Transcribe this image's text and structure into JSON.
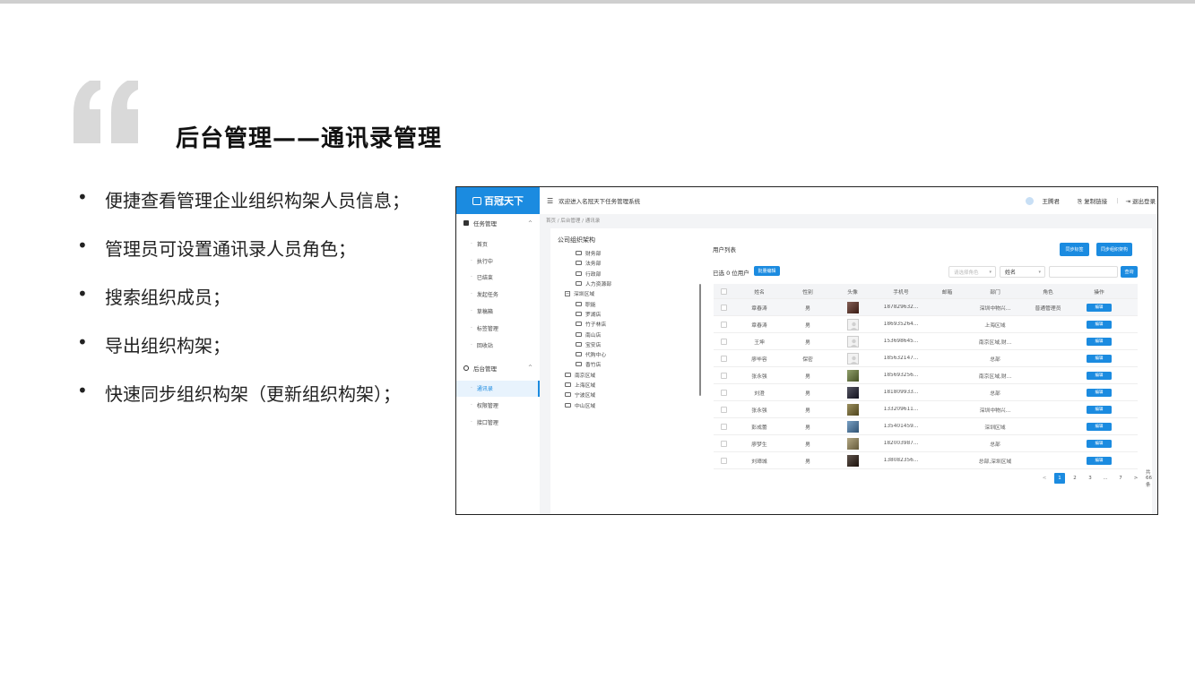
{
  "slide": {
    "title": "后台管理——通讯录管理",
    "bullets": [
      "便捷查看管理企业组织构架人员信息；",
      "管理员可设置通讯录人员角色；",
      "搜索组织成员；",
      "导出组织构架；",
      "快速同步组织构架（更新组织构架）；"
    ],
    "bullet_marker": "•"
  },
  "app": {
    "logo_text": "百冠天下",
    "welcome": "欢迎进入名冠天下任务管理系统",
    "user_name": "王腾君",
    "copy_link": "复制链接",
    "separator": "|",
    "logout": "退出登录",
    "menu_icon": "☰",
    "breadcrumb": "首页  /  后台管理  /  通讯录"
  },
  "sidebar": {
    "group1": {
      "label": "任务管理",
      "icon": "task-icon"
    },
    "group1_items": [
      "首页",
      "执行中",
      "已结束",
      "发起任务",
      "草稿箱",
      "标签管理",
      "回收站"
    ],
    "group2": {
      "label": "后台管理",
      "icon": "settings-icon"
    },
    "group2_items": [
      "通讯录",
      "权限管理",
      "接口管理"
    ],
    "active_item": "通讯录",
    "chevron": "^",
    "item_dot": "·"
  },
  "tree": {
    "title": "公司组织架构",
    "nodes": [
      {
        "label": "财务部",
        "level": 2,
        "type": "folder"
      },
      {
        "label": "法务部",
        "level": 2,
        "type": "folder"
      },
      {
        "label": "行政部",
        "level": 2,
        "type": "folder"
      },
      {
        "label": "人力资源部",
        "level": 2,
        "type": "folder"
      },
      {
        "label": "深圳区域",
        "level": 1,
        "type": "expanded"
      },
      {
        "label": "职能",
        "level": 2,
        "type": "folder"
      },
      {
        "label": "罗湖店",
        "level": 2,
        "type": "folder"
      },
      {
        "label": "竹子林店",
        "level": 2,
        "type": "folder"
      },
      {
        "label": "南山店",
        "level": 2,
        "type": "folder"
      },
      {
        "label": "宝安店",
        "level": 2,
        "type": "folder"
      },
      {
        "label": "代购中心",
        "level": 2,
        "type": "folder"
      },
      {
        "label": "香竹店",
        "level": 2,
        "type": "folder"
      },
      {
        "label": "南京区域",
        "level": 1,
        "type": "folder"
      },
      {
        "label": "上海区域",
        "level": 1,
        "type": "folder"
      },
      {
        "label": "宁波区域",
        "level": 1,
        "type": "folder"
      },
      {
        "label": "中山区域",
        "level": 1,
        "type": "folder"
      }
    ]
  },
  "list": {
    "title": "用户列表",
    "btn_sync_tag": "同步标签",
    "btn_sync_org": "同步组织架构",
    "selected_info": "已选 0 位用户",
    "btn_batch": "批量编辑",
    "role_placeholder": "请选择角色",
    "field_select": "姓名",
    "dropdown_arrow": "▾",
    "btn_search": "查询",
    "columns": [
      "姓名",
      "性别",
      "头像",
      "手机号",
      "邮箱",
      "部门",
      "角色",
      "操作"
    ],
    "edit_label": "编辑",
    "rows": [
      {
        "name": "章春涛",
        "sex": "男",
        "avatar": "photo",
        "color": "#5a2a1e",
        "phone": "187829632...",
        "email": "",
        "dept": "深圳中物兴...",
        "role": "普通管理员"
      },
      {
        "name": "章春涛",
        "sex": "男",
        "avatar": "default",
        "color": "#e0e0e0",
        "phone": "186935264...",
        "email": "",
        "dept": "上海区域",
        "role": ""
      },
      {
        "name": "王坤",
        "sex": "男",
        "avatar": "default",
        "color": "#e0e0e0",
        "phone": "153698645...",
        "email": "",
        "dept": "南京区域,财...",
        "role": ""
      },
      {
        "name": "廖毕容",
        "sex": "保密",
        "avatar": "default",
        "color": "#e0e0e0",
        "phone": "185632147...",
        "email": "",
        "dept": "总部",
        "role": ""
      },
      {
        "name": "张永强",
        "sex": "男",
        "avatar": "photo",
        "color": "#6b7f3a",
        "phone": "185693256...",
        "email": "",
        "dept": "南京区域,财...",
        "role": ""
      },
      {
        "name": "刘澄",
        "sex": "男",
        "avatar": "photo",
        "color": "#1c1c2e",
        "phone": "181809933...",
        "email": "",
        "dept": "总部",
        "role": ""
      },
      {
        "name": "张永强",
        "sex": "男",
        "avatar": "photo",
        "color": "#7a6a2a",
        "phone": "133209611...",
        "email": "",
        "dept": "深圳中物兴...",
        "role": ""
      },
      {
        "name": "彭成蕾",
        "sex": "男",
        "avatar": "photo",
        "color": "#4a7fb0",
        "phone": "135401459...",
        "email": "",
        "dept": "深圳区域",
        "role": ""
      },
      {
        "name": "廖梦生",
        "sex": "男",
        "avatar": "photo",
        "color": "#9a8a5a",
        "phone": "182003987...",
        "email": "",
        "dept": "总部",
        "role": ""
      },
      {
        "name": "刘璋城",
        "sex": "男",
        "avatar": "photo",
        "color": "#2a1a10",
        "phone": "138082356...",
        "email": "",
        "dept": "总部,深圳区域",
        "role": ""
      }
    ],
    "highlight_row": 0
  },
  "pager": {
    "prev": "<",
    "pages": [
      "1",
      "2",
      "3",
      "...",
      "7"
    ],
    "active": "1",
    "next": ">",
    "total": "共 66 条"
  }
}
